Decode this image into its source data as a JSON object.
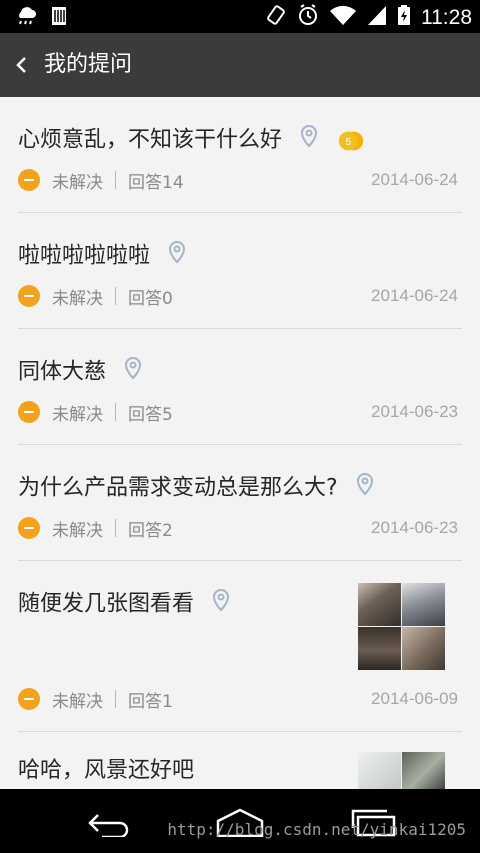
{
  "status_bar": {
    "time": "11:28",
    "icons": [
      "weather-icon",
      "sim-icon",
      "rotate-icon",
      "alarm-icon",
      "wifi-icon",
      "signal-icon",
      "battery-icon"
    ]
  },
  "appbar": {
    "title": "我的提问",
    "back_icon": "chevron-left-icon"
  },
  "questions": [
    {
      "title": "心烦意乱，不知该干什么好",
      "status": "未解决",
      "answers": "回答14",
      "date": "2014-06-24",
      "badge": "5"
    },
    {
      "title": "啦啦啦啦啦啦",
      "status": "未解决",
      "answers": "回答0",
      "date": "2014-06-24"
    },
    {
      "title": "同体大慈",
      "status": "未解决",
      "answers": "回答5",
      "date": "2014-06-23"
    },
    {
      "title": "为什么产品需求变动总是那么大?",
      "status": "未解决",
      "answers": "回答2",
      "date": "2014-06-23"
    },
    {
      "title": "随便发几张图看看",
      "status": "未解决",
      "answers": "回答1",
      "date": "2014-06-09"
    },
    {
      "title": "哈哈，风景还好吧"
    }
  ],
  "colors": {
    "status": "#f4a11b",
    "appbar": "#3b3b3b",
    "badge": "#f4be21"
  },
  "navbar": {
    "watermark": "http://blog.csdn.net/yinkai1205"
  }
}
